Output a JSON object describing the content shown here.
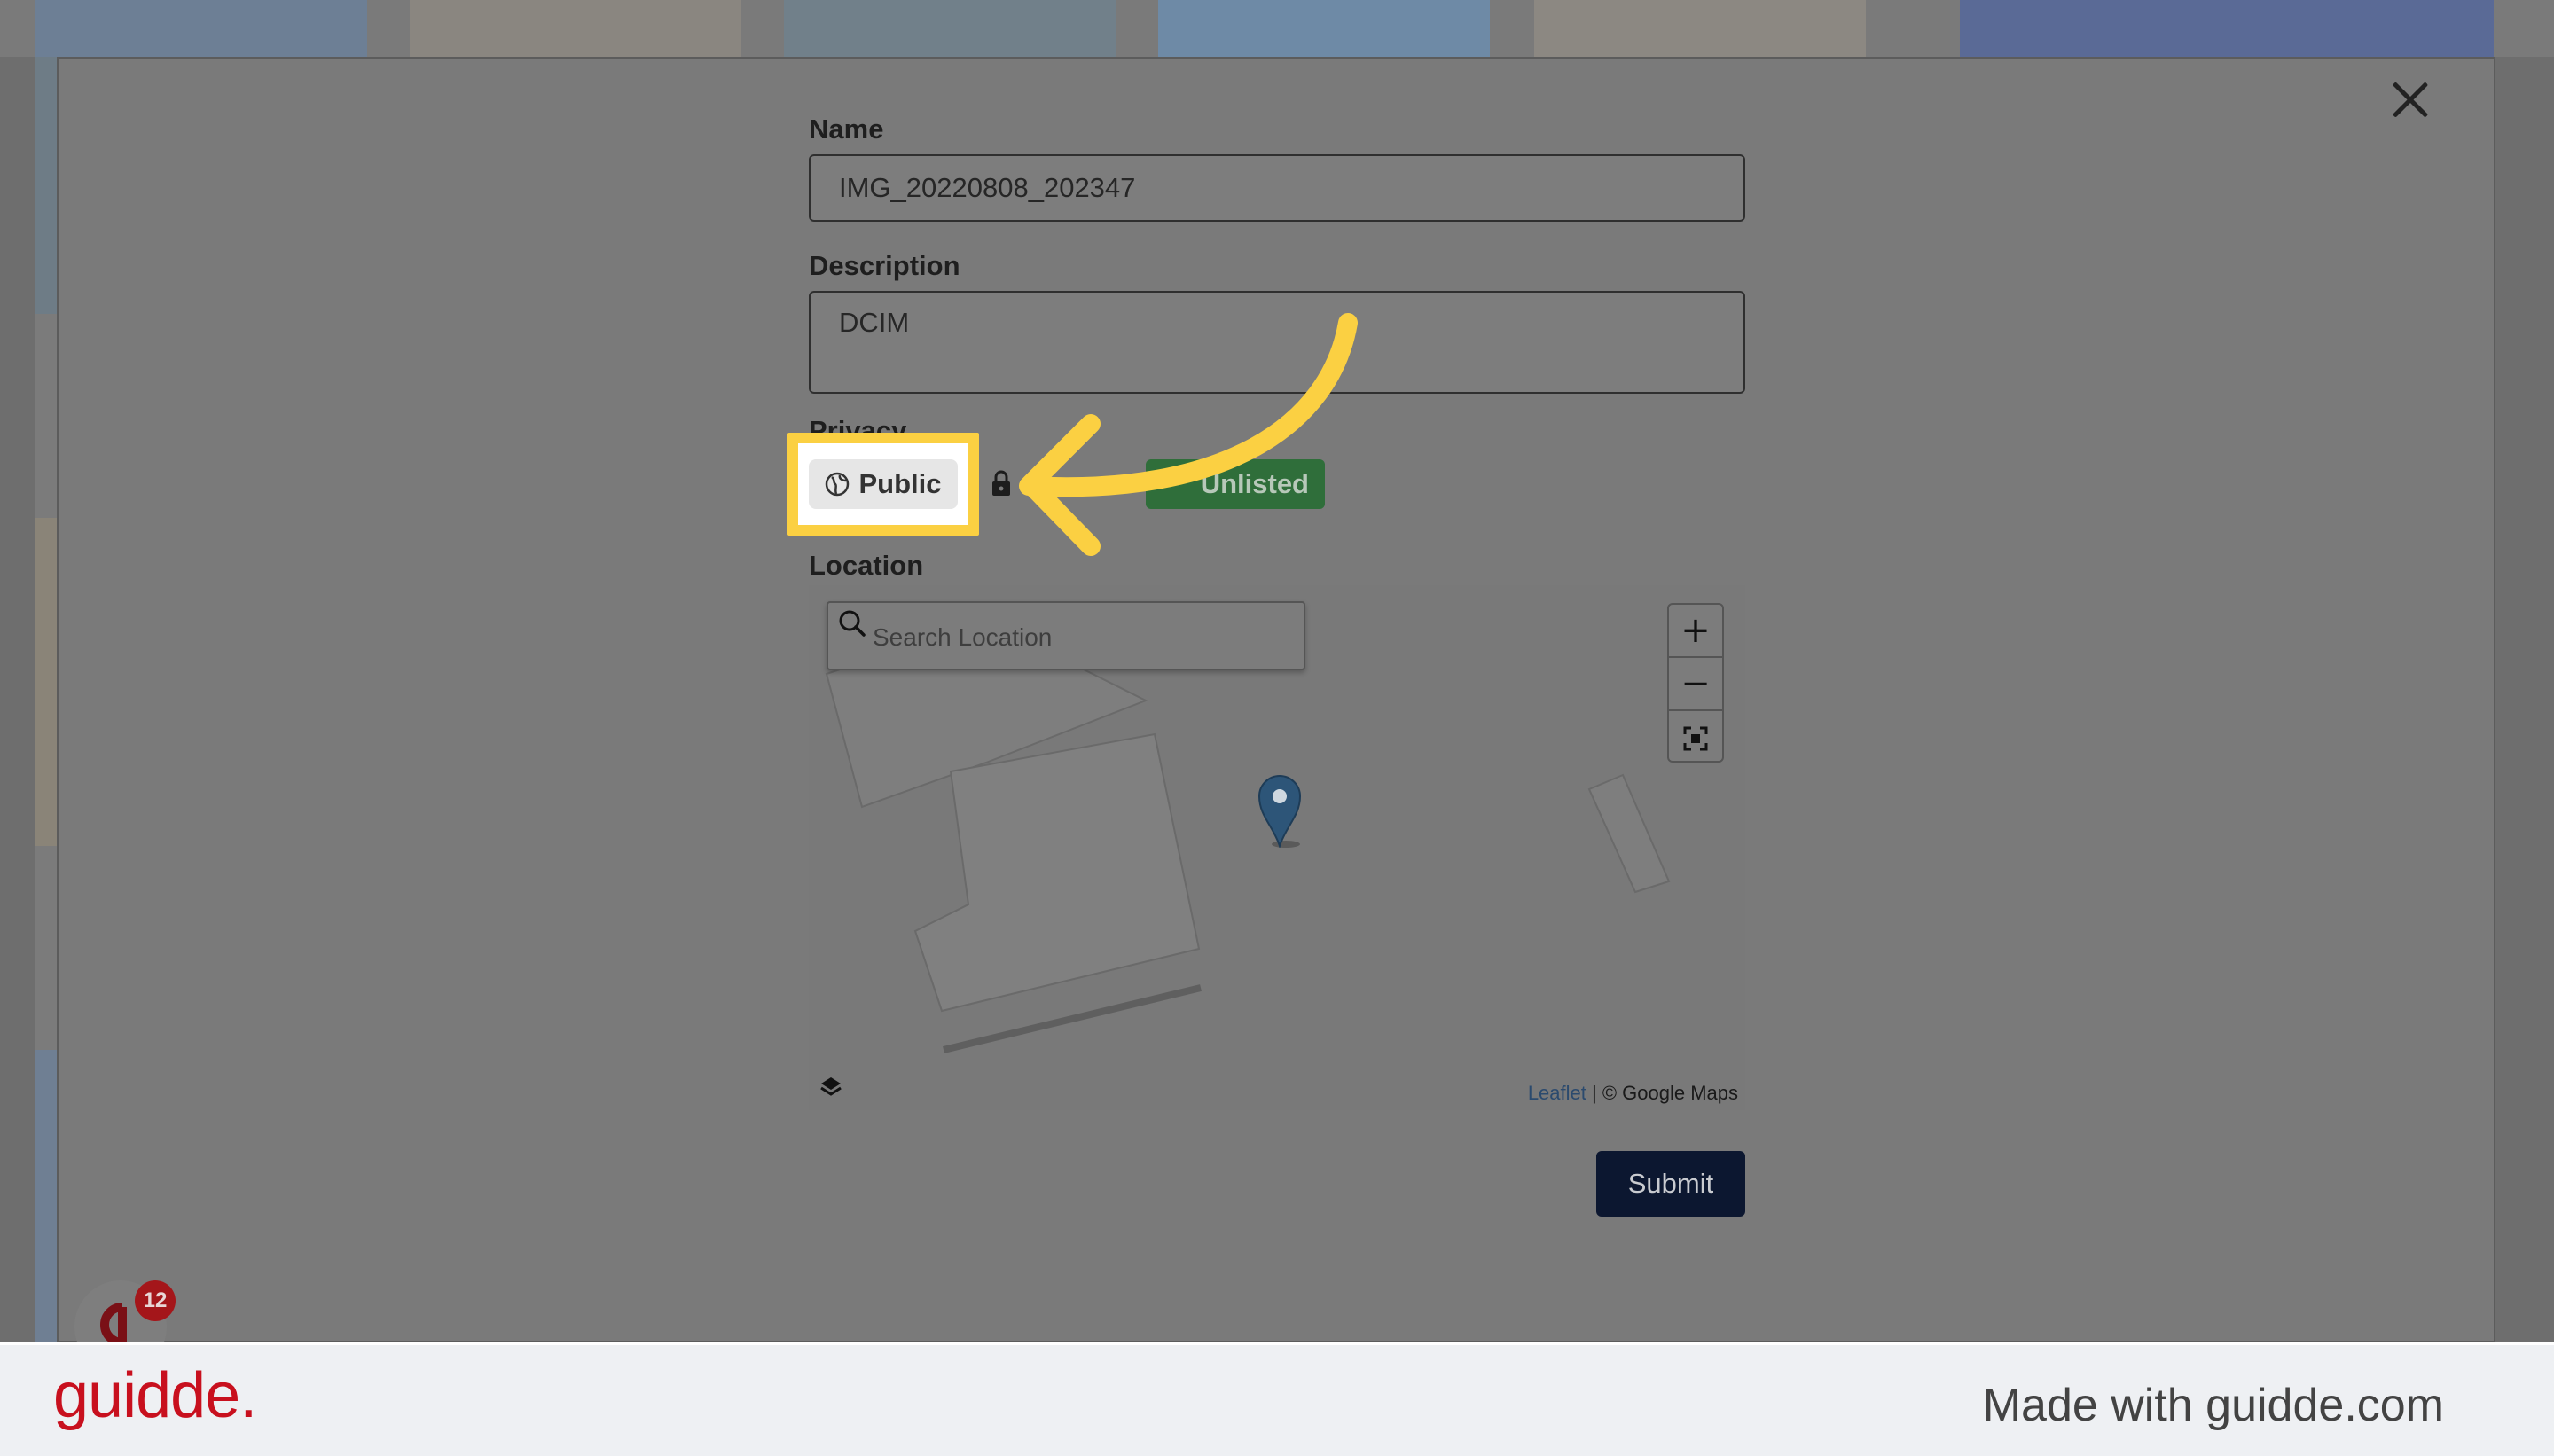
{
  "form": {
    "name_label": "Name",
    "name_value": "IMG_20220808_202347",
    "description_label": "Description",
    "description_value": "DCIM",
    "privacy_label": "Privacy",
    "privacy_options": {
      "public": "Public",
      "private_icon": "lock-icon",
      "unlisted": "Unlisted"
    },
    "location_label": "Location",
    "submit_label": "Submit"
  },
  "map": {
    "search_placeholder": "Search Location",
    "zoom_in": "+",
    "zoom_out": "−",
    "attribution_link": "Leaflet",
    "attribution_text": " | © Google Maps"
  },
  "widget": {
    "badge_count": "12"
  },
  "footer": {
    "brand": "guidde.",
    "made_with": "Made with guidde.com"
  },
  "colors": {
    "highlight": "#fbd042",
    "unlisted": "#2f6e3a",
    "submit": "#0c1730",
    "brand": "#c8101e"
  }
}
